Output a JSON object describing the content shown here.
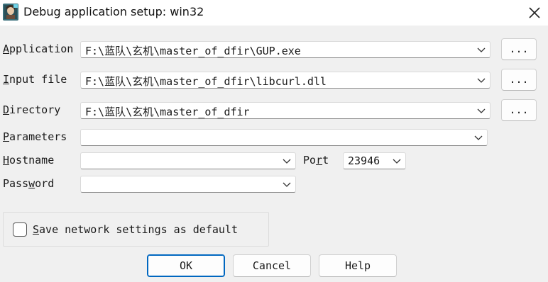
{
  "window": {
    "title": "Debug application setup: win32",
    "icon": "ida-app-icon",
    "close_icon": "close-icon"
  },
  "fields": {
    "application": {
      "label_hotkey": "A",
      "label_rest": "pplication",
      "value": "F:\\蓝队\\玄机\\master_of_dfir\\GUP.exe",
      "browse": "..."
    },
    "input_file": {
      "label_hotkey": "I",
      "label_rest": "nput file",
      "value": "F:\\蓝队\\玄机\\master_of_dfir\\libcurl.dll",
      "browse": "..."
    },
    "directory": {
      "label_hotkey": "D",
      "label_rest": "irectory",
      "value": "F:\\蓝队\\玄机\\master_of_dfir",
      "browse": "..."
    },
    "parameters": {
      "label_hotkey": "P",
      "label_rest": "arameters",
      "value": ""
    },
    "hostname": {
      "label_hotkey": "H",
      "label_rest": "ostname",
      "value": ""
    },
    "port": {
      "label_pre": "Po",
      "label_hotkey": "r",
      "label_rest": "t",
      "value": "23946"
    },
    "password": {
      "label_pre": "Pass",
      "label_hotkey": "w",
      "label_rest": "ord",
      "value": ""
    }
  },
  "save_settings": {
    "label_hotkey": "S",
    "label_rest": "ave network settings as default",
    "checked": false
  },
  "buttons": {
    "ok": "OK",
    "cancel": "Cancel",
    "help": "Help"
  },
  "colors": {
    "accent": "#0067c0",
    "background": "#f0f0f0"
  }
}
